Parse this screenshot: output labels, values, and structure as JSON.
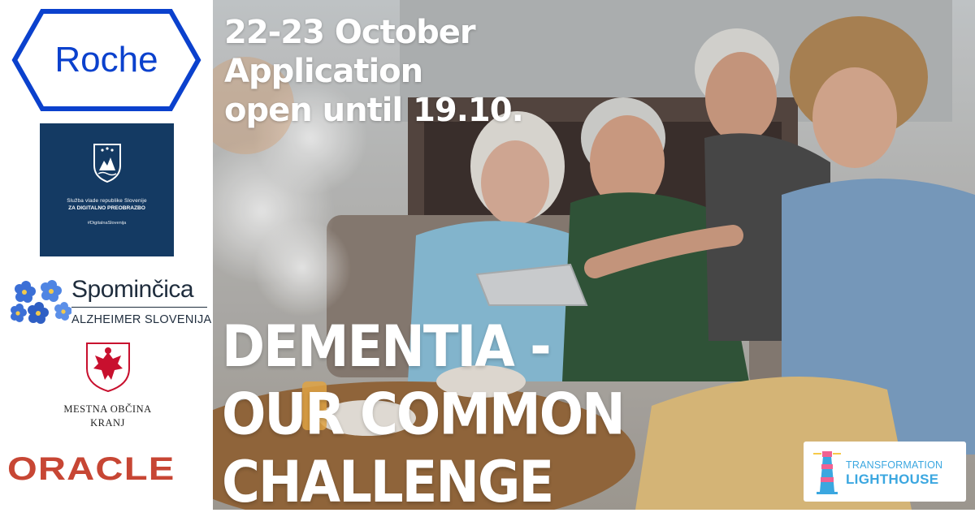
{
  "headline": {
    "line1": "22-23 October",
    "line2": "Application",
    "line3": "open until 19.10."
  },
  "title": {
    "line1": "DEMENTIA -",
    "line2": "OUR COMMON",
    "line3": "CHALLENGE"
  },
  "sponsors": {
    "roche": "Roche",
    "gov_line1": "Služba vlade republike Slovenije",
    "gov_line2": "ZA DIGITALNO PREOBRAZBO",
    "gov_tag": "#DigitalnaSlovenija",
    "spomincica_name": "Spominčica",
    "spomincica_sub": "ALZHEIMER SLOVENIJA",
    "kranj_line1": "MESTNA OBČINA",
    "kranj_line2": "KRANJ",
    "oracle": "ORACLE"
  },
  "lighthouse": {
    "line1": "TRANSFORMATION",
    "line2": "LIGHTHOUSE"
  },
  "colors": {
    "roche_blue": "#0b41cd",
    "gov_navy": "#143a63",
    "oracle_red": "#c74634",
    "lighthouse_blue": "#3ba7e0",
    "forget_me_not": "#3b6fd6"
  },
  "image_description": ""
}
